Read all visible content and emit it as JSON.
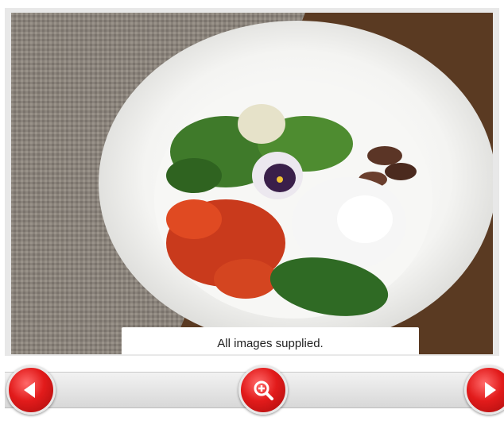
{
  "gallery": {
    "caption": "All images supplied."
  },
  "controls": {
    "prev_icon": "arrow-left-icon",
    "zoom_icon": "zoom-in-icon",
    "next_icon": "arrow-right-icon",
    "accent_color": "#e21b1b"
  }
}
